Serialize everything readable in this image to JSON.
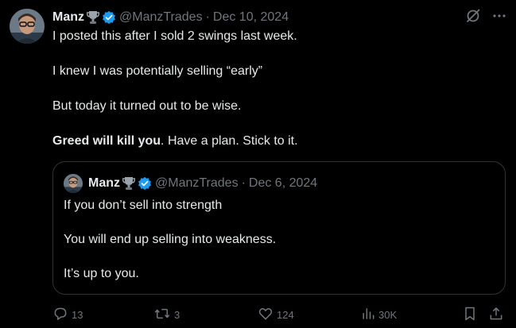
{
  "tweet": {
    "author_name": "Manz",
    "author_handle": "@ManzTrades",
    "separator": "·",
    "date": "Dec 10, 2024",
    "paragraphs": [
      "I posted this after I sold 2 swings last week.",
      "I knew I was potentially selling “early”",
      "But today it turned out to be wise."
    ],
    "last_paragraph_bold": "Greed will kill you",
    "last_paragraph_rest": ". Have a plan. Stick to it."
  },
  "quote": {
    "author_name": "Manz",
    "author_handle": "@ManzTrades",
    "separator": "·",
    "date": "Dec 6, 2024",
    "paragraphs": [
      "If you don’t sell into strength",
      "You will end up selling into weakness.",
      "It’s up to you."
    ]
  },
  "actions": {
    "replies": "13",
    "reposts": "3",
    "likes": "124",
    "views": "30K"
  },
  "icons": {
    "verified": "verified-badge-icon",
    "trophy": "trophy-emoji-icon",
    "grok": "grok-icon",
    "more": "more-icon",
    "reply": "reply-icon",
    "repost": "repost-icon",
    "like": "like-icon",
    "views": "views-icon",
    "bookmark": "bookmark-icon",
    "share": "share-icon"
  },
  "colors": {
    "background": "#000000",
    "text": "#e7e9ea",
    "muted": "#71767b",
    "border": "#2f3336",
    "verified": "#1d9bf0"
  }
}
